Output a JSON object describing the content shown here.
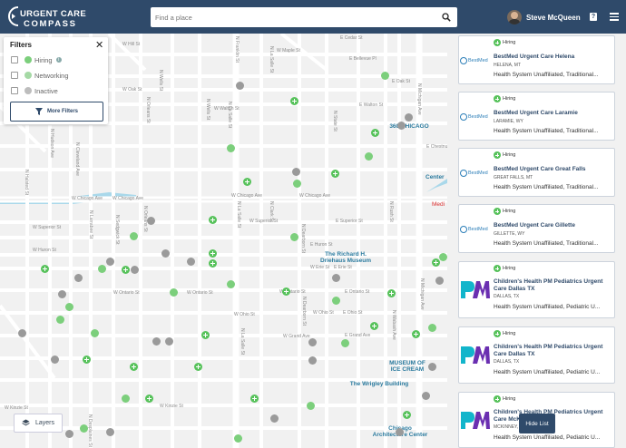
{
  "header": {
    "logo_line1": "URGENT CARE",
    "logo_line2": "COMPASS",
    "search_placeholder": "Find a place",
    "user_name": "Steve McQueen",
    "help_label": "?"
  },
  "filters": {
    "title": "Filters",
    "options": [
      {
        "label": "Hiring",
        "color": "#7ccf7c",
        "info": true
      },
      {
        "label": "Networking",
        "color": "#a5d9a5"
      },
      {
        "label": "Inactive",
        "color": "#bdbdbd"
      }
    ],
    "more_button": "More Filters"
  },
  "map": {
    "layers_button": "Layers",
    "streets": {
      "w_chicago": "W Chicago Ave",
      "w_chicago2": "W Chicago Ave",
      "w_chicago3": "W Chicago Ave",
      "w_superior": "W Superior St",
      "w_superior2": "W Superior St",
      "w_huron": "W Huron St",
      "w_erie": "W Erie St",
      "w_ontario": "W Ontario St",
      "w_ontario2": "W Ontario St",
      "w_ohio": "W Ohio St",
      "w_grand": "W Grand Ave",
      "w_kinzie": "W Kinzie St",
      "w_kinzie2": "W Kinzie St",
      "w_oak": "W Oak St",
      "w_walton": "W Walton St",
      "w_maple": "W Maple St",
      "w_hill": "W Hill St",
      "e_cedar": "E Cedar St",
      "e_bellevue": "E Bellevue Pl",
      "e_oak": "E Oak St",
      "e_walton": "E Walton St",
      "e_chestnut": "E Chestnut St",
      "e_superior": "E Superior St",
      "e_huron": "E Huron St",
      "e_erie": "E Erie St",
      "e_ontario": "E Ontario St",
      "e_ohio": "E Ohio St",
      "e_grand": "E Grand Ave",
      "n_state": "N State St",
      "n_dearborn": "N Dearborn St",
      "n_clark": "N Clark St",
      "n_lasalle": "N La Salle St",
      "n_wells": "N Wells St",
      "n_franklin": "N Franklin St",
      "n_orleans": "N Orleans St",
      "n_sedgwick": "N Sedgwick St",
      "n_hudson": "N Hudson Ave",
      "n_rush": "N Rush St",
      "n_michigan": "N Michigan Ave",
      "n_wabash": "N Wabash Ave",
      "n_larrabee": "N Larrabee St",
      "n_kingsbury": "N Kingsbury St",
      "n_cleveland": "N Cleveland Ave",
      "n_halsted": "N Halsted St",
      "n_jefferson": "N Jefferson St",
      "n_desplaines": "N Desplaines St"
    },
    "pois": {
      "driehaus": "The Richard H. Driehaus Museum",
      "icecream": "MUSEUM OF ICE CREAM",
      "wrigley": "The Wrigley Building",
      "chicago360": "360 CHICAGO",
      "arch_center": "Chicago Architecture Center",
      "medical": "Medi",
      "center": "Center"
    }
  },
  "list": {
    "hide_button": "Hide List",
    "cards": [
      {
        "status": "Hiring",
        "name": "BestMed Urgent Care Helena",
        "location": "HELENA, MT",
        "system": "Health System Unaffiliated, Traditional...",
        "logo": "BestMed"
      },
      {
        "status": "Hiring",
        "name": "BestMed Urgent Care Laramie",
        "location": "LARAMIE, WY",
        "system": "Health System Unaffiliated, Traditional...",
        "logo": "BestMed"
      },
      {
        "status": "Hiring",
        "name": "BestMed Urgent Care Great Falls",
        "location": "GREAT FALLS, MT",
        "system": "Health System Unaffiliated, Traditional...",
        "logo": "BestMed"
      },
      {
        "status": "Hiring",
        "name": "BestMed Urgent Care Gillette",
        "location": "GILLETTE, WY",
        "system": "Health System Unaffiliated, Traditional...",
        "logo": "BestMed"
      },
      {
        "status": "Hiring",
        "name": "Children's Health PM Pediatrics Urgent Care Dallas TX",
        "location": "DALLAS, TX",
        "system": "Health System Unaffiliated, Pediatric U...",
        "logo": "PM"
      },
      {
        "status": "Hiring",
        "name": "Children's Health PM Pediatrics Urgent Care Dallas TX",
        "location": "DALLAS, TX",
        "system": "Health System Unaffiliated, Pediatric U...",
        "logo": "PM"
      },
      {
        "status": "Hiring",
        "name": "Children's Health PM Pediatrics Urgent Care McKinney TX",
        "location": "MCKINNEY, TX",
        "system": "Health System Unaffiliated, Pediatric U...",
        "logo": "PM"
      }
    ]
  }
}
